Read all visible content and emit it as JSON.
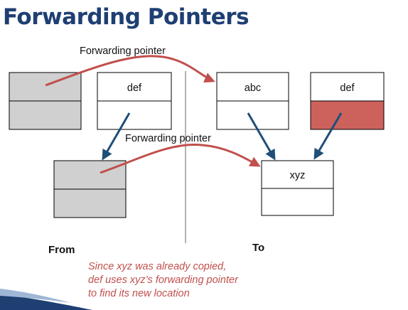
{
  "title": "Forwarding Pointers",
  "labels": {
    "forwarding_pointer_top": "Forwarding pointer",
    "forwarding_pointer_middle": "Forwarding pointer",
    "from": "From",
    "to": "To"
  },
  "cells": {
    "def_from": "def",
    "abc_to": "abc",
    "def_to": "def",
    "xyz_to": "xyz"
  },
  "note": {
    "line1": "Since xyz was already copied,",
    "line2": "def uses xyz’s forwarding pointer",
    "line3": "to find its new location"
  },
  "colors": {
    "title": "#1f3f73",
    "forwarding_arrow": "#c0504d",
    "reference_arrow": "#1f4e79",
    "evacuated_fill": "#d0d0d0",
    "copied_fill": "#cd625c",
    "note_text": "#c0504d"
  }
}
